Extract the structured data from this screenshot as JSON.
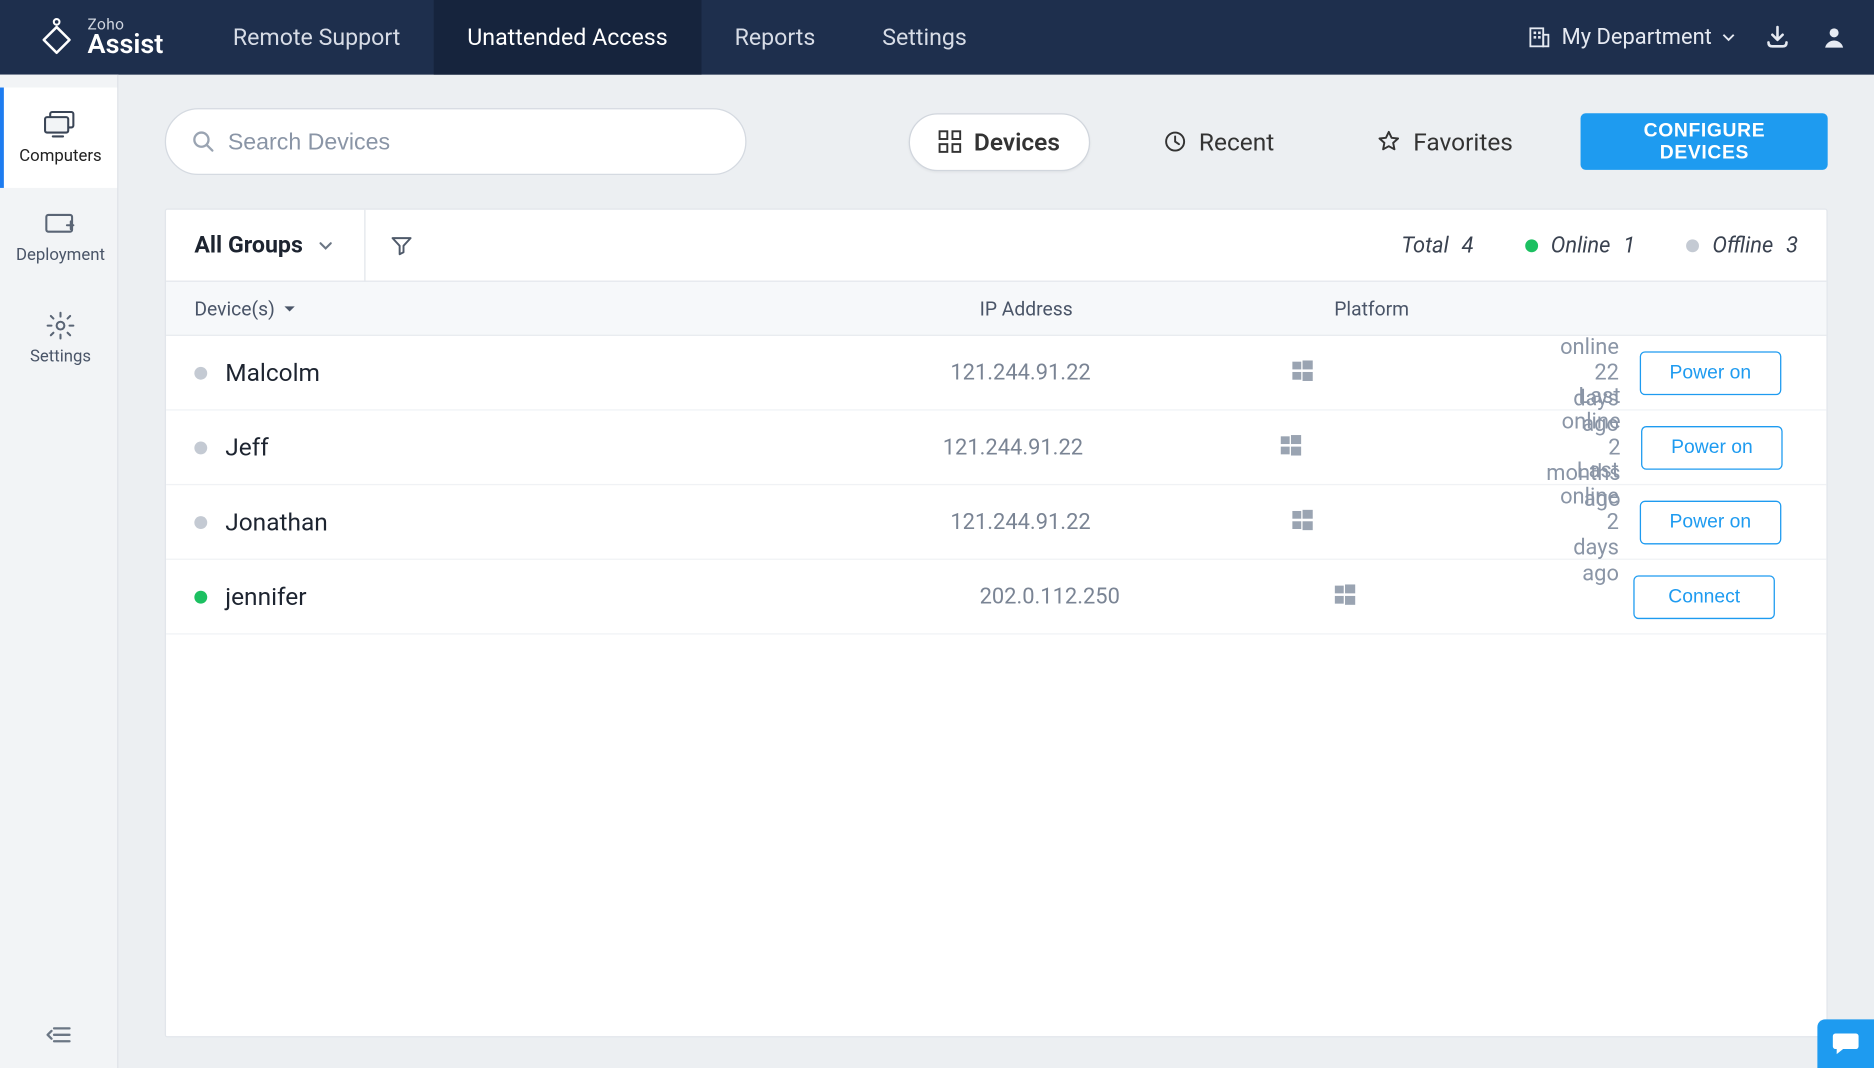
{
  "brand": {
    "top": "Zoho",
    "name": "Assist"
  },
  "topnav": {
    "tabs": [
      {
        "label": "Remote Support"
      },
      {
        "label": "Unattended Access"
      },
      {
        "label": "Reports"
      },
      {
        "label": "Settings"
      }
    ],
    "department": "My Department"
  },
  "sidebar": {
    "items": [
      {
        "label": "Computers"
      },
      {
        "label": "Deployment"
      },
      {
        "label": "Settings"
      }
    ]
  },
  "toolbar": {
    "search_placeholder": "Search Devices",
    "segments": [
      {
        "label": "Devices"
      },
      {
        "label": "Recent"
      },
      {
        "label": "Favorites"
      }
    ],
    "configure_label": "CONFIGURE DEVICES"
  },
  "groups": {
    "selector_label": "All Groups",
    "stats": {
      "total_label": "Total",
      "total_value": "4",
      "online_label": "Online",
      "online_value": "1",
      "offline_label": "Offline",
      "offline_value": "3"
    }
  },
  "table": {
    "headers": {
      "device": "Device(s)",
      "ip": "IP Address",
      "platform": "Platform"
    },
    "rows": [
      {
        "name": "Malcolm",
        "ip": "121.244.91.22",
        "online": false,
        "status": "Last online 22 days ago",
        "action": "Power on"
      },
      {
        "name": "Jeff",
        "ip": "121.244.91.22",
        "online": false,
        "status": "Last online 2 months ago",
        "action": "Power on"
      },
      {
        "name": "Jonathan",
        "ip": "121.244.91.22",
        "online": false,
        "status": "Last online 2 days ago",
        "action": "Power on"
      },
      {
        "name": "jennifer",
        "ip": "202.0.112.250",
        "online": true,
        "status": "",
        "action": "Connect"
      }
    ]
  }
}
